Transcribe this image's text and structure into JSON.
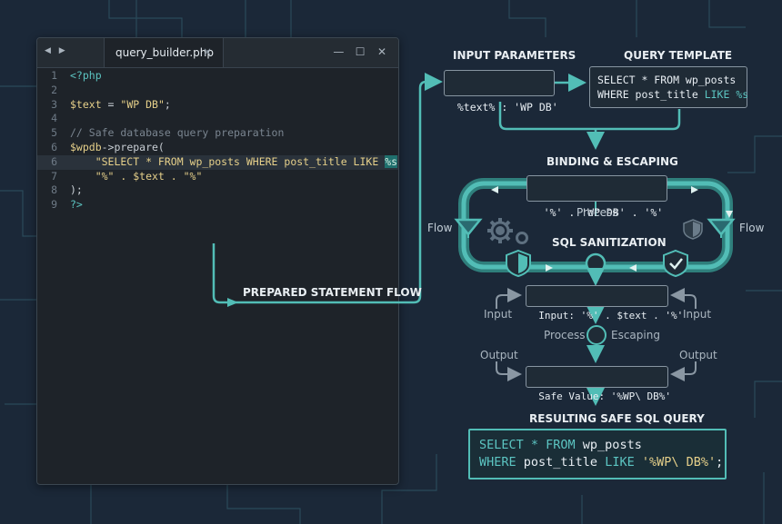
{
  "editor": {
    "tab_title": "query_builder.php",
    "tab_close": "×",
    "nav": [
      "◀",
      "▶"
    ],
    "window_controls": [
      "—",
      "☐",
      "✕"
    ],
    "lines": [
      {
        "n": "1",
        "parts": [
          {
            "t": "<?php",
            "c": "cyan"
          }
        ]
      },
      {
        "n": "2",
        "parts": []
      },
      {
        "n": "3",
        "parts": [
          {
            "t": "$text",
            "c": "yellow"
          },
          {
            "t": " = ",
            "c": "op"
          },
          {
            "t": "\"WP DB\"",
            "c": "yellow"
          },
          {
            "t": ";",
            "c": "op"
          }
        ]
      },
      {
        "n": "4",
        "parts": []
      },
      {
        "n": "5",
        "parts": [
          {
            "t": "// Safe database query preparation",
            "c": "comment"
          }
        ]
      },
      {
        "n": "6",
        "parts": [
          {
            "t": "$wpdb",
            "c": "yellow"
          },
          {
            "t": "->prepare(",
            "c": "op"
          }
        ]
      },
      {
        "n": "6",
        "highlight": true,
        "parts": [
          {
            "t": "    \"SELECT * FROM wp_posts WHERE post_title LIKE ",
            "c": "yellow"
          },
          {
            "t": "%s",
            "c": "mark"
          },
          {
            "t": "\",",
            "c": "yellow"
          }
        ]
      },
      {
        "n": "7",
        "parts": [
          {
            "t": "    \"%\" . $text . \"%\"",
            "c": "yellow"
          }
        ]
      },
      {
        "n": "8",
        "parts": [
          {
            "t": ");",
            "c": "op"
          }
        ]
      },
      {
        "n": "9",
        "parts": [
          {
            "t": "?>",
            "c": "cyan"
          }
        ]
      }
    ]
  },
  "flow_label": "PREPARED STATEMENT FLOW",
  "input_parameters": {
    "title": "INPUT PARAMETERS",
    "value": "%text% : 'WP DB'"
  },
  "query_template": {
    "title": "QUERY TEMPLATE",
    "line1": "SELECT * FROM wp_posts",
    "line2_prefix": "WHERE post_title ",
    "line2_keyword": "LIKE %s"
  },
  "binding": {
    "title": "BINDING & ESCAPING",
    "value": "'%' . 'WP DB' . '%'",
    "process": "Process"
  },
  "loop_labels": {
    "flow_left": "Flow",
    "flow_right": "Flow"
  },
  "sanitization": {
    "title": "SQL SANITIZATION"
  },
  "input_box": {
    "value": "Input: '%' . $text . '%'",
    "left_label": "Input",
    "right_label": "Input"
  },
  "process_row": {
    "left": "Process",
    "right": "Escaping"
  },
  "output_row": {
    "left": "Output",
    "right": "Output"
  },
  "safe_value": {
    "value": "Safe Value: '%WP\\ DB%'"
  },
  "result": {
    "title": "RESULTING SAFE SQL QUERY",
    "line1_kw": "SELECT * FROM",
    "line1_rest": " wp_posts",
    "line2_kw": "WHERE",
    "line2_mid": " post_title ",
    "line2_kw2": "LIKE",
    "line2_str": " '%WP\\ DB%'",
    "line2_end": ";"
  },
  "colors": {
    "background": "#1b2838",
    "accent": "#52bdb6",
    "string": "#e6d08a",
    "keyword": "#5cc5c2"
  },
  "icons": [
    "gear-icon",
    "shield-icon",
    "shield-check-icon",
    "funnel-icon"
  ]
}
